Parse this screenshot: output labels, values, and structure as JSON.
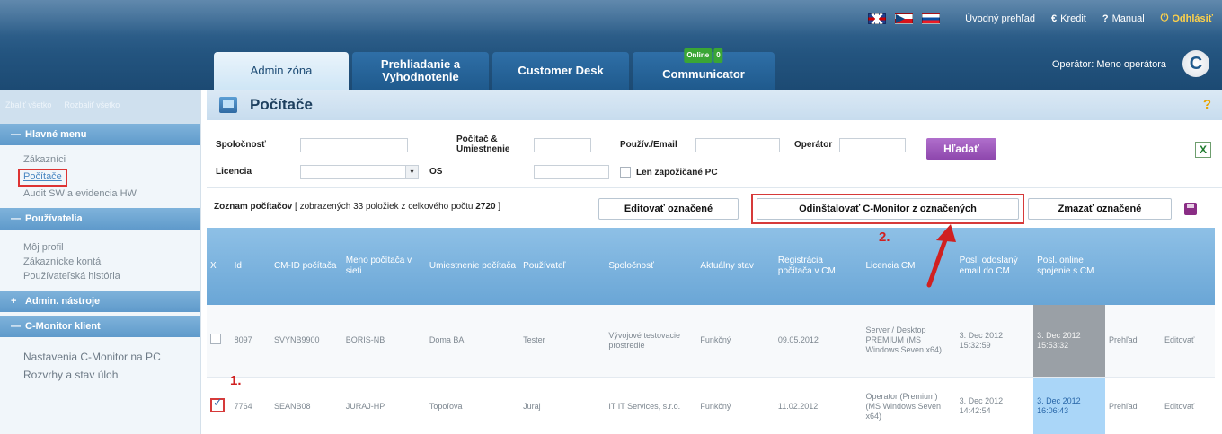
{
  "header": {
    "links": {
      "overview": "Úvodný prehľad",
      "credit": "Kredit",
      "manual": "Manual",
      "logout": "Odhlásiť"
    },
    "tabs": [
      {
        "label": "Admin zóna"
      },
      {
        "label": "Prehliadanie a Vyhodnotenie"
      },
      {
        "label": "Customer Desk"
      },
      {
        "label": "Communicator",
        "online": "Online",
        "count": "0"
      }
    ],
    "operator": "Operátor: Meno operátora",
    "logo_letter": "C"
  },
  "sidebar": {
    "collapse_all": "Zbaliť všetko",
    "expand_all": "Rozbaliť všetko",
    "sections": [
      {
        "title": "Hlavné menu",
        "sign": "—",
        "items": [
          "Zákazníci",
          "Počítače",
          "Audit SW a evidencia HW"
        ]
      },
      {
        "title": "Používatelia",
        "sign": "—",
        "items": [
          "Môj profil",
          "Zákaznícke kontá",
          "Používateľská história"
        ]
      },
      {
        "title": "Admin. nástroje",
        "sign": "+",
        "items": []
      },
      {
        "title": "C-Monitor klient",
        "sign": "—",
        "items": [
          "Nastavenia C-Monitor na PC",
          "Rozvrhy a stav úloh"
        ]
      }
    ]
  },
  "page": {
    "title": "Počítače",
    "help": "?"
  },
  "filters": {
    "company_label": "Spoločnosť",
    "computer_label": "Počítač & Umiestnenie",
    "user_label": "Použív./Email",
    "operator_label": "Operátor",
    "license_label": "Licencia",
    "os_label": "OS",
    "loaned_label": "Len zapožičané PC",
    "search_button": "Hľadať",
    "excel_icon": "X"
  },
  "list": {
    "prefix": "Zoznam počítačov",
    "shown_text": " [ zobrazených ",
    "shown_count": "33",
    "middle_text": " položiek z celkového počtu ",
    "total_count": "2720",
    "suffix": " ]",
    "edit_button": "Editovať označené",
    "uninstall_button": "Odinštalovať C-Monitor z označených",
    "delete_button": "Zmazať označené"
  },
  "table": {
    "columns": [
      "X",
      "Id",
      "CM-ID počítača",
      "Meno počítača v sieti",
      "Umiestnenie počítača",
      "Používateľ",
      "Spoločnosť",
      "Aktuálny stav",
      "Registrácia počítača v CM",
      "Licencia CM",
      "Posl. odoslaný email do CM",
      "Posl. online spojenie s CM",
      "",
      ""
    ],
    "rows": [
      {
        "id": "8097",
        "cmid": "SVYNB9900",
        "name": "BORIS-NB",
        "location": "Doma BA",
        "user": "Tester",
        "company": "Vývojové testovacie prostredie",
        "status": "Funkčný",
        "registered": "09.05.2012",
        "license": "Server / Desktop PREMIUM (MS Windows Seven x64)",
        "last_email": "3. Dec 2012 15:32:59",
        "last_online": "3. Dec 2012 15:53:32",
        "overview": "Prehľad",
        "edit": "Editovať"
      },
      {
        "id": "7764",
        "cmid": "SEANB08",
        "name": "JURAJ-HP",
        "location": "Topoľova",
        "user": "Juraj",
        "company": "IT IT Services, s.r.o.",
        "status": "Funkčný",
        "registered": "11.02.2012",
        "license": "Operator (Premium) (MS Windows Seven x64)",
        "last_email": "3. Dec 2012 14:42:54",
        "last_online": "3. Dec 2012 16:06:43",
        "overview": "Prehľad",
        "edit": "Editovať"
      }
    ]
  },
  "annotations": {
    "step1": "1.",
    "step2": "2."
  }
}
